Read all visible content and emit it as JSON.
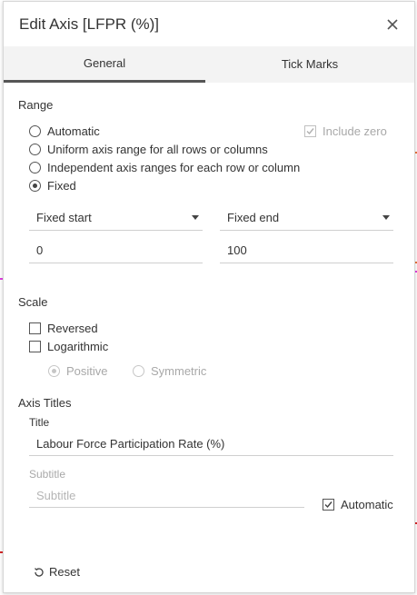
{
  "dialog": {
    "title": "Edit Axis [LFPR (%)]",
    "close_icon": "close-icon"
  },
  "tabs": [
    {
      "label": "General",
      "active": true
    },
    {
      "label": "Tick Marks",
      "active": false
    }
  ],
  "range": {
    "heading": "Range",
    "options": [
      {
        "label": "Automatic",
        "selected": false
      },
      {
        "label": "Uniform axis range for all rows or columns",
        "selected": false
      },
      {
        "label": "Independent axis ranges for each row or column",
        "selected": false
      },
      {
        "label": "Fixed",
        "selected": true
      }
    ],
    "include_zero": {
      "label": "Include zero",
      "checked": true,
      "disabled": true
    },
    "start_dropdown": "Fixed start",
    "end_dropdown": "Fixed end",
    "start_value": "0",
    "end_value": "100"
  },
  "scale": {
    "heading": "Scale",
    "reversed": {
      "label": "Reversed",
      "checked": false
    },
    "logarithmic": {
      "label": "Logarithmic",
      "checked": false
    },
    "positive": {
      "label": "Positive",
      "selected": true,
      "disabled": true
    },
    "symmetric": {
      "label": "Symmetric",
      "selected": false,
      "disabled": true
    }
  },
  "axis_titles": {
    "heading": "Axis Titles",
    "title_label": "Title",
    "title_value": "Labour Force Participation Rate (%)",
    "subtitle_label": "Subtitle",
    "subtitle_placeholder": "Subtitle",
    "automatic": {
      "label": "Automatic",
      "checked": true
    }
  },
  "footer": {
    "reset_label": "Reset"
  },
  "colors": {
    "text": "#333333",
    "disabled_text": "#a8a8a8",
    "tab_bg": "#f3f3f3",
    "active_tab_underline": "#555555",
    "backdrop_orange": "#e8743b",
    "backdrop_magenta": "#e040e0",
    "backdrop_red": "#d62728"
  }
}
